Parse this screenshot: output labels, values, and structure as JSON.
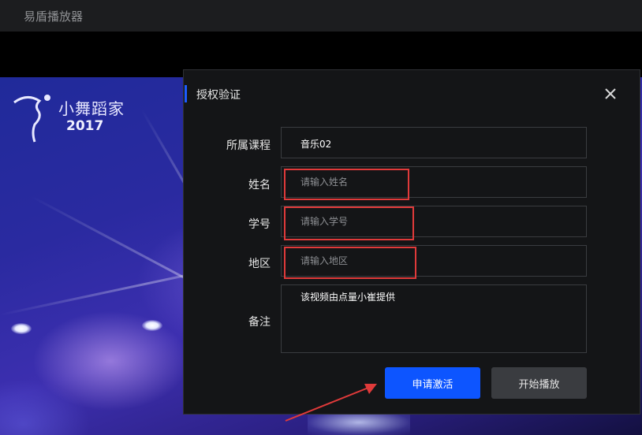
{
  "app": {
    "title": "易盾播放器"
  },
  "video": {
    "logo": {
      "brand_text": "小舞蹈家",
      "year": "2017"
    }
  },
  "dialog": {
    "title": "授权验证",
    "fields": {
      "course": {
        "label": "所属课程",
        "value": "音乐02"
      },
      "name": {
        "label": "姓名",
        "placeholder": "请输入姓名",
        "value": ""
      },
      "student_id": {
        "label": "学号",
        "placeholder": "请输入学号",
        "value": ""
      },
      "region": {
        "label": "地区",
        "placeholder": "请输入地区",
        "value": ""
      },
      "remark": {
        "label": "备注",
        "value": "该视频由点量小崔提供"
      }
    },
    "buttons": {
      "apply_activation": "申请激活",
      "start_playback": "开始播放"
    }
  },
  "colors": {
    "accent": "#0d55ff",
    "annotation": "#e03a3a",
    "dialog_bg": "#141517",
    "titlebar_bg": "#1c1d1f"
  },
  "icons": {
    "close": "close-icon",
    "arrow": "annotation-arrow"
  }
}
